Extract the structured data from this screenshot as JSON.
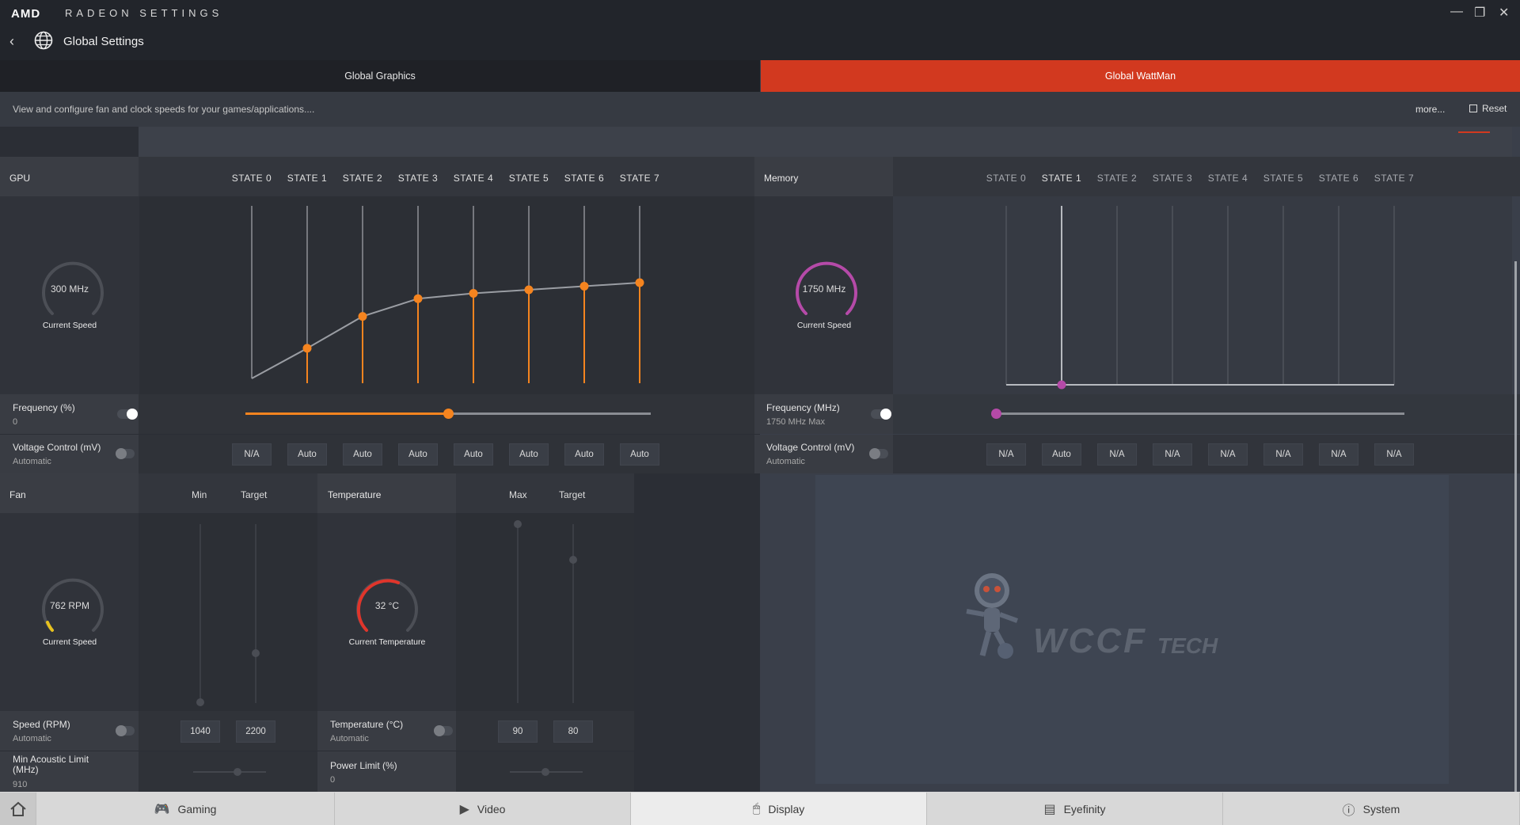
{
  "app": {
    "brand": "AMD",
    "title": "RADEON SETTINGS",
    "page_title": "Global Settings"
  },
  "tabs": [
    {
      "label": "Global Graphics",
      "active": false
    },
    {
      "label": "Global WattMan",
      "active": true
    }
  ],
  "description": "View and configure fan and clock speeds for your games/applications....",
  "more_label": "more...",
  "reset_label": "Reset",
  "gpu": {
    "header": "GPU",
    "states": [
      "STATE 0",
      "STATE 1",
      "STATE 2",
      "STATE 3",
      "STATE 4",
      "STATE 5",
      "STATE 6",
      "STATE 7"
    ],
    "current_speed": "300 MHz",
    "current_speed_caption": "Current Speed",
    "frequency_label": "Frequency (%)",
    "frequency_value": "0",
    "frequency_slider": 0.5,
    "voltage_label": "Voltage Control (mV)",
    "voltage_mode": "Automatic",
    "voltage_values": [
      "N/A",
      "Auto",
      "Auto",
      "Auto",
      "Auto",
      "Auto",
      "Auto",
      "Auto"
    ],
    "curve_levels": [
      0.0,
      0.17,
      0.35,
      0.45,
      0.48,
      0.5,
      0.52,
      0.54
    ],
    "accent": "#f5841f"
  },
  "memory": {
    "header": "Memory",
    "states": [
      "STATE 0",
      "STATE 1",
      "STATE 2",
      "STATE 3",
      "STATE 4",
      "STATE 5",
      "STATE 6",
      "STATE 7"
    ],
    "active_state": 1,
    "current_speed": "1750 MHz",
    "current_speed_caption": "Current Speed",
    "frequency_label": "Frequency (MHz)",
    "frequency_value": "1750 MHz Max",
    "voltage_label": "Voltage Control (mV)",
    "voltage_mode": "Automatic",
    "voltage_values": [
      "N/A",
      "Auto",
      "N/A",
      "N/A",
      "N/A",
      "N/A",
      "N/A",
      "N/A"
    ],
    "accent": "#b54aa8"
  },
  "fan": {
    "header": "Fan",
    "col_min": "Min",
    "col_target": "Target",
    "current_speed": "762 RPM",
    "current_speed_caption": "Current Speed",
    "speed_label": "Speed (RPM)",
    "speed_mode": "Automatic",
    "min_value": "1040",
    "target_value": "2200",
    "acoustic_label": "Min Acoustic Limit (MHz)",
    "acoustic_value": "910",
    "accent": "#e7c21e"
  },
  "temperature": {
    "header": "Temperature",
    "col_max": "Max",
    "col_target": "Target",
    "current": "32 °C",
    "current_caption": "Current Temperature",
    "temp_label": "Temperature (°C)",
    "temp_mode": "Automatic",
    "max_value": "90",
    "target_value": "80",
    "power_label": "Power Limit (%)",
    "power_value": "0",
    "accent": "#e0352b"
  },
  "watermark": {
    "text_main": "WCCF",
    "text_sub": "TECH"
  },
  "bottom_nav": [
    {
      "label": "Gaming",
      "icon": "gamepad-icon"
    },
    {
      "label": "Video",
      "icon": "play-icon"
    },
    {
      "label": "Display",
      "icon": "monitor-icon",
      "active": true
    },
    {
      "label": "Eyefinity",
      "icon": "eyefinity-icon"
    },
    {
      "label": "System",
      "icon": "info-icon"
    }
  ]
}
